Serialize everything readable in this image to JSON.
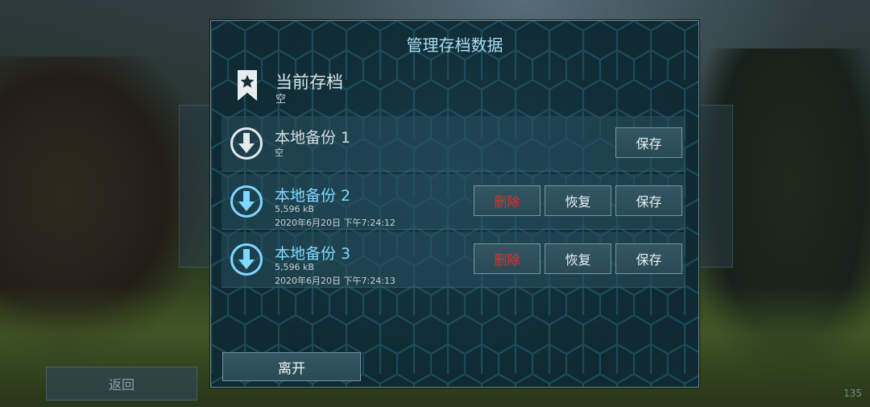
{
  "background": {
    "back_label": "返回",
    "fps": "135"
  },
  "dialog": {
    "title": "管理存档数据",
    "current": {
      "icon": "bookmark-star-icon",
      "title": "当前存档",
      "subtitle": "空"
    },
    "slots": [
      {
        "title": "本地备份 1",
        "size": "空",
        "date": "",
        "icon": "download-arrow-icon",
        "delete_label": "",
        "restore_label": "",
        "save_label": "保存"
      },
      {
        "title": "本地备份 2",
        "size": "5,596 kB",
        "date": "2020年6月20日 下午7:24:12",
        "icon": "download-arrow-icon",
        "delete_label": "删除",
        "restore_label": "恢复",
        "save_label": "保存"
      },
      {
        "title": "本地备份 3",
        "size": "5,596 kB",
        "date": "2020年6月20日 下午7:24:13",
        "icon": "download-arrow-icon",
        "delete_label": "删除",
        "restore_label": "恢复",
        "save_label": "保存"
      }
    ],
    "leave_label": "离开"
  },
  "colors": {
    "title": "#a9ddf2",
    "active_slot": "#7fd8ff",
    "danger": "#e0302a",
    "panel": "#0f2a33"
  }
}
